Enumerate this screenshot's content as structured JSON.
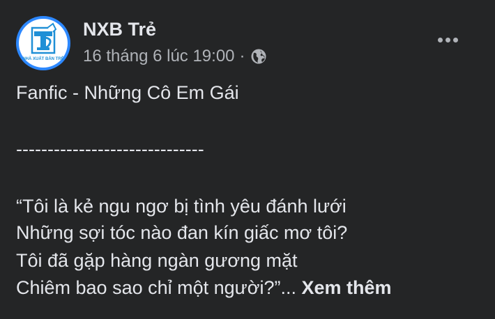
{
  "post": {
    "author": "NXB Trẻ",
    "avatar_logo_text": "NHÀ XUẤT BẢN TRẺ",
    "timestamp": "16 tháng 6 lúc 19:00",
    "separator": "·",
    "audience_icon": "globe-icon",
    "more_icon": "more-options-icon",
    "lines": {
      "title": "Fanfic - Những Cô Em Gái",
      "divider": "------------------------------",
      "verse1": "“Tôi là kẻ ngu ngơ bị tình yêu đánh lưới",
      "verse2": "Những sợi tóc nào đan kín giấc mơ tôi?",
      "verse3": "Tôi đã gặp hàng ngàn gương mặt",
      "verse4": "Chiêm bao sao chỉ một người?”..."
    },
    "see_more_label": "Xem thêm"
  },
  "colors": {
    "background": "#242526",
    "primary_text": "#e4e6eb",
    "secondary_text": "#b0b3b8",
    "avatar_ring": "#2d88ff"
  }
}
